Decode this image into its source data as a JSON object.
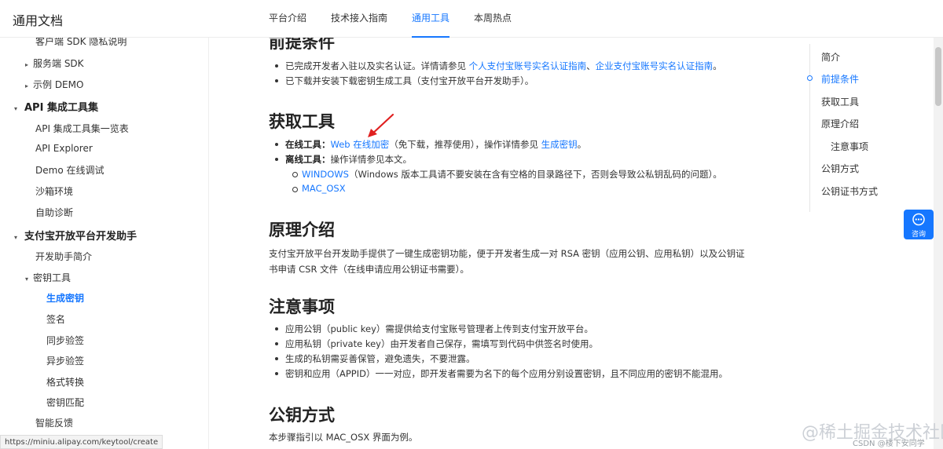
{
  "header": {
    "brand": "通用文档",
    "nav": [
      "平台介绍",
      "技术接入指南",
      "通用工具",
      "本周热点"
    ],
    "active_nav": "通用工具"
  },
  "sidebar": {
    "items": [
      {
        "label": "客户端 SDK 隐私说明"
      },
      {
        "label": "服务端 SDK"
      },
      {
        "label": "示例 DEMO"
      },
      {
        "label": "API 集成工具集"
      },
      {
        "label": "API 集成工具集一览表"
      },
      {
        "label": "API Explorer"
      },
      {
        "label": "Demo 在线调试"
      },
      {
        "label": "沙箱环境"
      },
      {
        "label": "自助诊断"
      },
      {
        "label": "支付宝开放平台开发助手"
      },
      {
        "label": "开发助手简介"
      },
      {
        "label": "密钥工具"
      },
      {
        "label": "生成密钥"
      },
      {
        "label": "签名"
      },
      {
        "label": "同步验签"
      },
      {
        "label": "异步验签"
      },
      {
        "label": "格式转换"
      },
      {
        "label": "密钥匹配"
      },
      {
        "label": "智能反馈"
      }
    ],
    "status_url": "https://miniu.alipay.com/keytool/create"
  },
  "content": {
    "prereq": {
      "title": "前提条件",
      "b1_text": "已完成开发者入驻以及实名认证。详情请参见",
      "b1_link1": "个人支付宝账号实名认证指南",
      "b1_sep": "、",
      "b1_link2": "企业支付宝账号实名认证指南",
      "b1_end": "。",
      "b2_text": "已下载并安装下载密钥生成工具（支付宝开放平台开发助手）。"
    },
    "get_tool": {
      "title": "获取工具",
      "online_label": "在线工具：",
      "online_link": "Web 在线加密",
      "online_mid": "（免下载，推荐使用），操作详情参见",
      "online_link2": "生成密钥",
      "online_end": "。",
      "offline_label": "离线工具：",
      "offline_text": "操作详情参见本文。",
      "windows_link": "WINDOWS",
      "windows_note": "（Windows 版本工具请不要安装在含有空格的目录路径下，否则会导致公私钥乱码的问题）。",
      "mac_link": "MAC_OSX"
    },
    "principle": {
      "title": "原理介绍",
      "p1": "支付宝开放平台开发助手提供了一键生成密钥功能，便于开发者生成一对 RSA 密钥（应用公钥、应用私钥）以及公钥证",
      "p2": "书申请 CSR 文件（在线申请应用公钥证书需要）。"
    },
    "notes": {
      "title": "注意事项",
      "n1": "应用公钥（public key）需提供给支付宝账号管理者上传到支付宝开放平台。",
      "n2": "应用私钥（private key）由开发者自己保存，需填写到代码中供签名时使用。",
      "n3": "生成的私钥需妥善保管，避免遗失，不要泄露。",
      "n4": "密钥和应用（APPID）一一对应，即开发者需要为名下的每个应用分别设置密钥，且不同应用的密钥不能混用。"
    },
    "pubkey": {
      "title": "公钥方式",
      "p": "本步骤指引以 MAC_OSX 界面为例。"
    }
  },
  "toc": {
    "items": [
      "简介",
      "前提条件",
      "获取工具",
      "原理介绍",
      "注意事项",
      "公钥方式",
      "公钥证书方式"
    ],
    "active": "前提条件"
  },
  "consult": {
    "label": "咨询"
  },
  "watermark": {
    "text": "@稀土掘金技术社区",
    "sub": "CSDN @楼下安同学"
  },
  "colors": {
    "accent": "#1677ff",
    "text": "#333333",
    "arrow": "#e02020"
  }
}
